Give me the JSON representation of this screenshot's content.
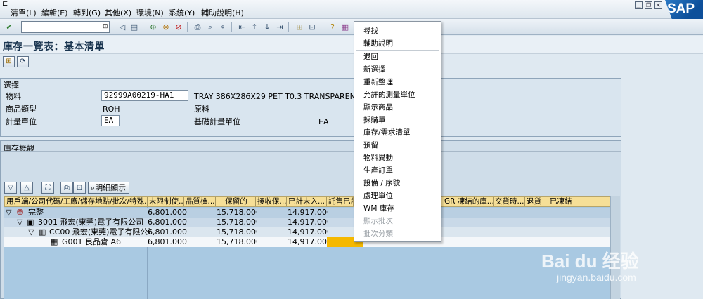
{
  "menubar": {
    "items": [
      "清單(L)",
      "編輯(E)",
      "轉到(G)",
      "其他(X)",
      "環境(N)",
      "系統(Y)",
      "輔助說明(H)"
    ]
  },
  "toolbar": {
    "command_value": "",
    "command_end_glyph": "⊡"
  },
  "branding": {
    "sap_logo": "SAP"
  },
  "page": {
    "title": "庫存一覽表：基本清單"
  },
  "selection": {
    "group_title": "選擇",
    "material_label": "物料",
    "material_value": "92999A00219-HA1",
    "material_desc": "TRAY 386X286X29 PET T0.3 TRANSPARENT",
    "material_type_label": "商品類型",
    "material_type_code": "ROH",
    "material_type_desc": "原料",
    "uom_label": "計量單位",
    "uom_value": "EA",
    "base_uom_label": "基礎計量單位",
    "base_uom_value": "EA"
  },
  "overview": {
    "group_title": "庫存概觀",
    "detail_button": "明細顯示",
    "columns": [
      "用戶端/公司代碼/工廠/儲存地點/批次/特殊...",
      "未限制使...",
      "品質檢...",
      "保留的",
      "接收保...",
      "已計未入...",
      "託售已計...",
      "GR 凍結的庫...",
      "交貨時...",
      "退貨",
      "已凍結"
    ],
    "rows": [
      {
        "name": "完整",
        "unrestricted": "6,801.000",
        "reserved": "15,718.000",
        "ordered": "14,917.000"
      },
      {
        "name": "3001 飛宏(東莞)電子有限公司",
        "unrestricted": "6,801.000",
        "reserved": "15,718.000",
        "ordered": "14,917.000"
      },
      {
        "name": "CC00 飛宏(東莞)電子有限公司",
        "unrestricted": "6,801.000",
        "reserved": "15,718.000",
        "ordered": "14,917.000"
      },
      {
        "name": "G001 良品倉 A6",
        "unrestricted": "6,801.000",
        "reserved": "15,718.000",
        "ordered": "14,917.000"
      }
    ]
  },
  "context_menu": {
    "items": [
      {
        "label": "尋找",
        "enabled": true
      },
      {
        "label": "輔助說明",
        "enabled": true
      },
      {
        "label": "退回",
        "enabled": true
      },
      {
        "label": "新選擇",
        "enabled": true
      },
      {
        "label": "重新整理",
        "enabled": true
      },
      {
        "label": "允許的測量單位",
        "enabled": true
      },
      {
        "label": "顯示商品",
        "enabled": true
      },
      {
        "label": "採購單",
        "enabled": true
      },
      {
        "label": "庫存/需求清單",
        "enabled": true
      },
      {
        "label": "預留",
        "enabled": true
      },
      {
        "label": "物料異動",
        "enabled": true
      },
      {
        "label": "生產訂單",
        "enabled": true
      },
      {
        "label": "設備 / 序號",
        "enabled": true
      },
      {
        "label": "處理單位",
        "enabled": true
      },
      {
        "label": "WM 庫存",
        "enabled": true
      },
      {
        "label": "顯示批次",
        "enabled": false
      },
      {
        "label": "批次分類",
        "enabled": false
      }
    ]
  },
  "watermark": {
    "logo": "Bai du 经验",
    "url": "jingyan.baidu.com"
  },
  "colors": {
    "grid_header": "#f6df97",
    "grid_body": "#a9c9e2",
    "selected_cell": "#f5b800",
    "sap_blue": "#0d4f9a"
  }
}
